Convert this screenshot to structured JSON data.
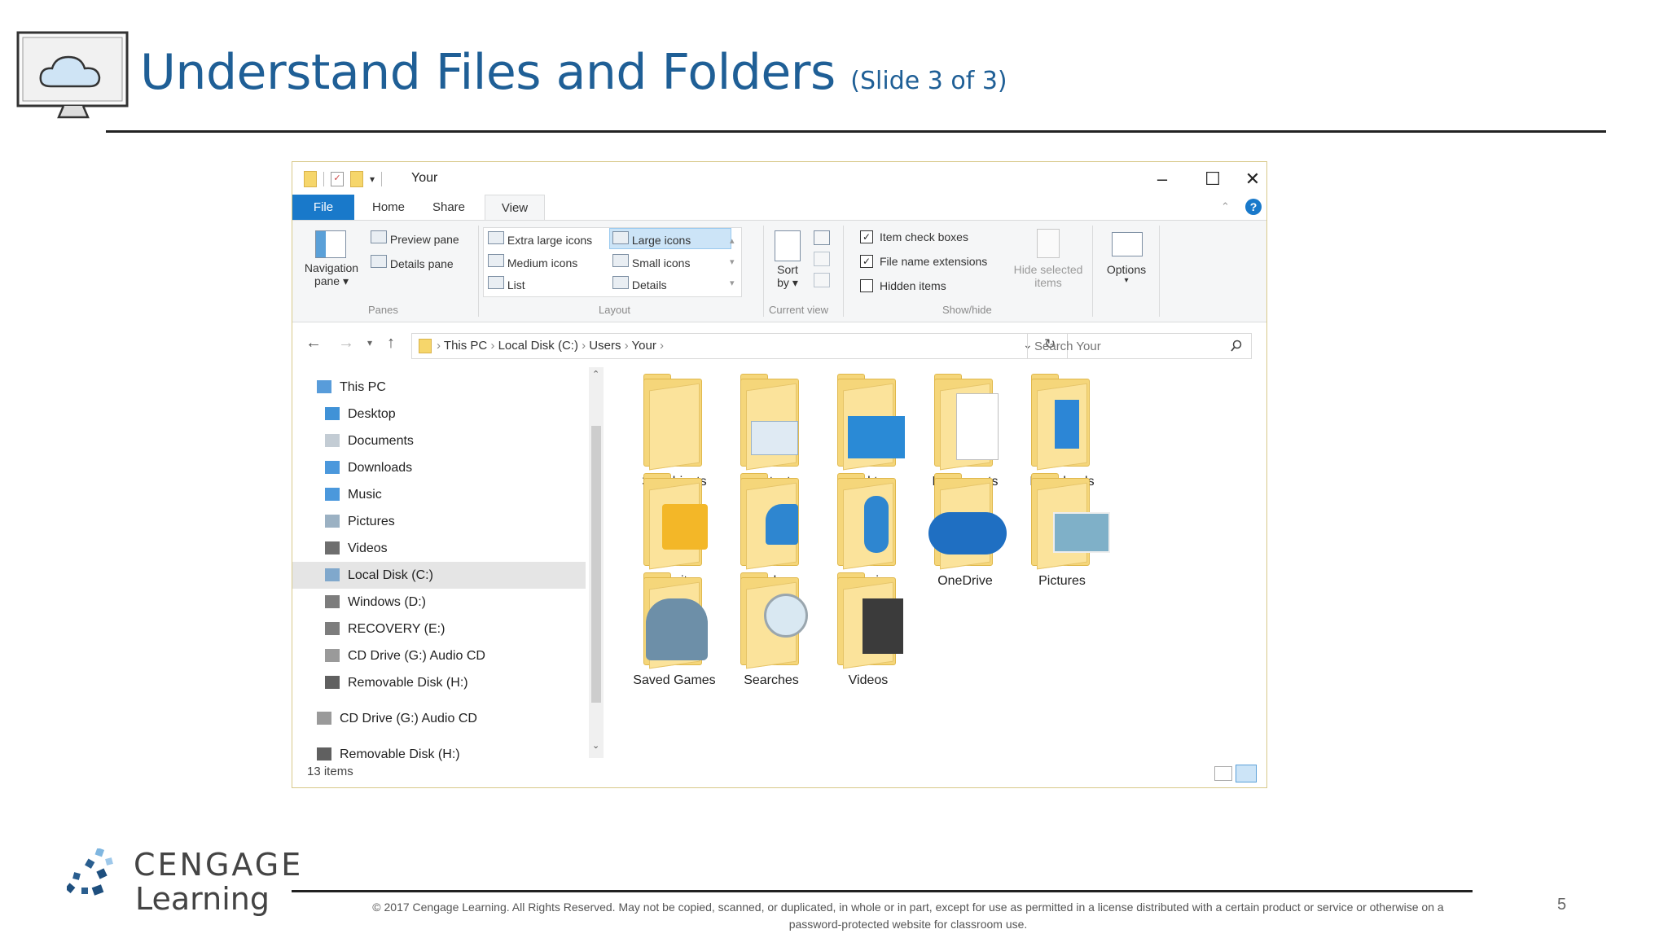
{
  "slide": {
    "title": "Understand Files and Folders",
    "subtitle": "(Slide 3 of 3)",
    "page_number": "5",
    "copyright_line1": "© 2017 Cengage Learning. All Rights Reserved. May not be copied, scanned, or duplicated, in whole or in part, except for use as permitted in a license distributed with a certain product or service or otherwise on a",
    "copyright_line2": "password-protected website for classroom use.",
    "logo_line1": "CENGAGE",
    "logo_line2": "Learning"
  },
  "window": {
    "title": "Your",
    "menu": {
      "file": "File",
      "home": "Home",
      "share": "Share",
      "view": "View"
    },
    "help_glyph": "?",
    "ribbon": {
      "panes": {
        "navigation_pane": "Navigation",
        "navigation_pane2": "pane",
        "preview_pane": "Preview pane",
        "details_pane": "Details pane",
        "group_label": "Panes"
      },
      "layout": {
        "extra_large_icons": "Extra large icons",
        "large_icons": "Large icons",
        "medium_icons": "Medium icons",
        "small_icons": "Small icons",
        "list": "List",
        "details": "Details",
        "group_label": "Layout"
      },
      "current_view": {
        "sort": "Sort",
        "sort_by": "by",
        "group_label": "Current view"
      },
      "show_hide": {
        "item_check_boxes": "Item check boxes",
        "file_name_extensions": "File name extensions",
        "hidden_items": "Hidden items",
        "hide_selected": "Hide selected",
        "hide_selected2": "items",
        "group_label": "Show/hide",
        "item_check_boxes_checked": true,
        "file_name_extensions_checked": true,
        "hidden_items_checked": false
      },
      "options": "Options"
    },
    "address": {
      "crumbs": [
        "This PC",
        "Local Disk (C:)",
        "Users",
        "Your"
      ],
      "search_placeholder": "Search Your"
    },
    "nav_items": [
      {
        "label": "This PC",
        "icon": "pc-icon",
        "selected": false
      },
      {
        "label": "Desktop",
        "icon": "desktop-icon",
        "selected": false
      },
      {
        "label": "Documents",
        "icon": "documents-icon",
        "selected": false
      },
      {
        "label": "Downloads",
        "icon": "downloads-icon",
        "selected": false
      },
      {
        "label": "Music",
        "icon": "music-icon",
        "selected": false
      },
      {
        "label": "Pictures",
        "icon": "pictures-icon",
        "selected": false
      },
      {
        "label": "Videos",
        "icon": "videos-icon",
        "selected": false
      },
      {
        "label": "Local Disk (C:)",
        "icon": "local-disk-icon",
        "selected": true
      },
      {
        "label": "Windows (D:)",
        "icon": "drive-icon",
        "selected": false
      },
      {
        "label": "RECOVERY (E:)",
        "icon": "drive-icon",
        "selected": false
      },
      {
        "label": "CD Drive (G:) Audio CD",
        "icon": "cd-drive-icon",
        "selected": false
      },
      {
        "label": "Removable Disk (H:)",
        "icon": "removable-disk-icon",
        "selected": false
      },
      {
        "label": "CD Drive (G:) Audio CD",
        "icon": "cd-drive-icon",
        "selected": false
      },
      {
        "label": "Removable Disk (H:)",
        "icon": "removable-disk-icon",
        "selected": false
      }
    ],
    "folders": [
      {
        "label": "3D Objects",
        "badge": "none"
      },
      {
        "label": "Contacts",
        "badge": "contact-card-icon"
      },
      {
        "label": "Desktop",
        "badge": "desktop-tile-icon"
      },
      {
        "label": "Documents",
        "badge": "document-page-icon"
      },
      {
        "label": "Downloads",
        "badge": "down-arrow-icon"
      },
      {
        "label": "Favorites",
        "badge": "star-icon"
      },
      {
        "label": "Links",
        "badge": "link-arrow-icon"
      },
      {
        "label": "Music",
        "badge": "music-note-icon"
      },
      {
        "label": "OneDrive",
        "badge": "cloud-icon"
      },
      {
        "label": "Pictures",
        "badge": "landscape-photo-icon"
      },
      {
        "label": "Saved Games",
        "badge": "chess-piece-icon"
      },
      {
        "label": "Searches",
        "badge": "magnifier-icon"
      },
      {
        "label": "Videos",
        "badge": "film-strip-icon"
      }
    ],
    "status": "13 items",
    "colors": {
      "accent": "#1979ca",
      "folder": "#f5d67a",
      "title": "#1f5f96"
    }
  }
}
